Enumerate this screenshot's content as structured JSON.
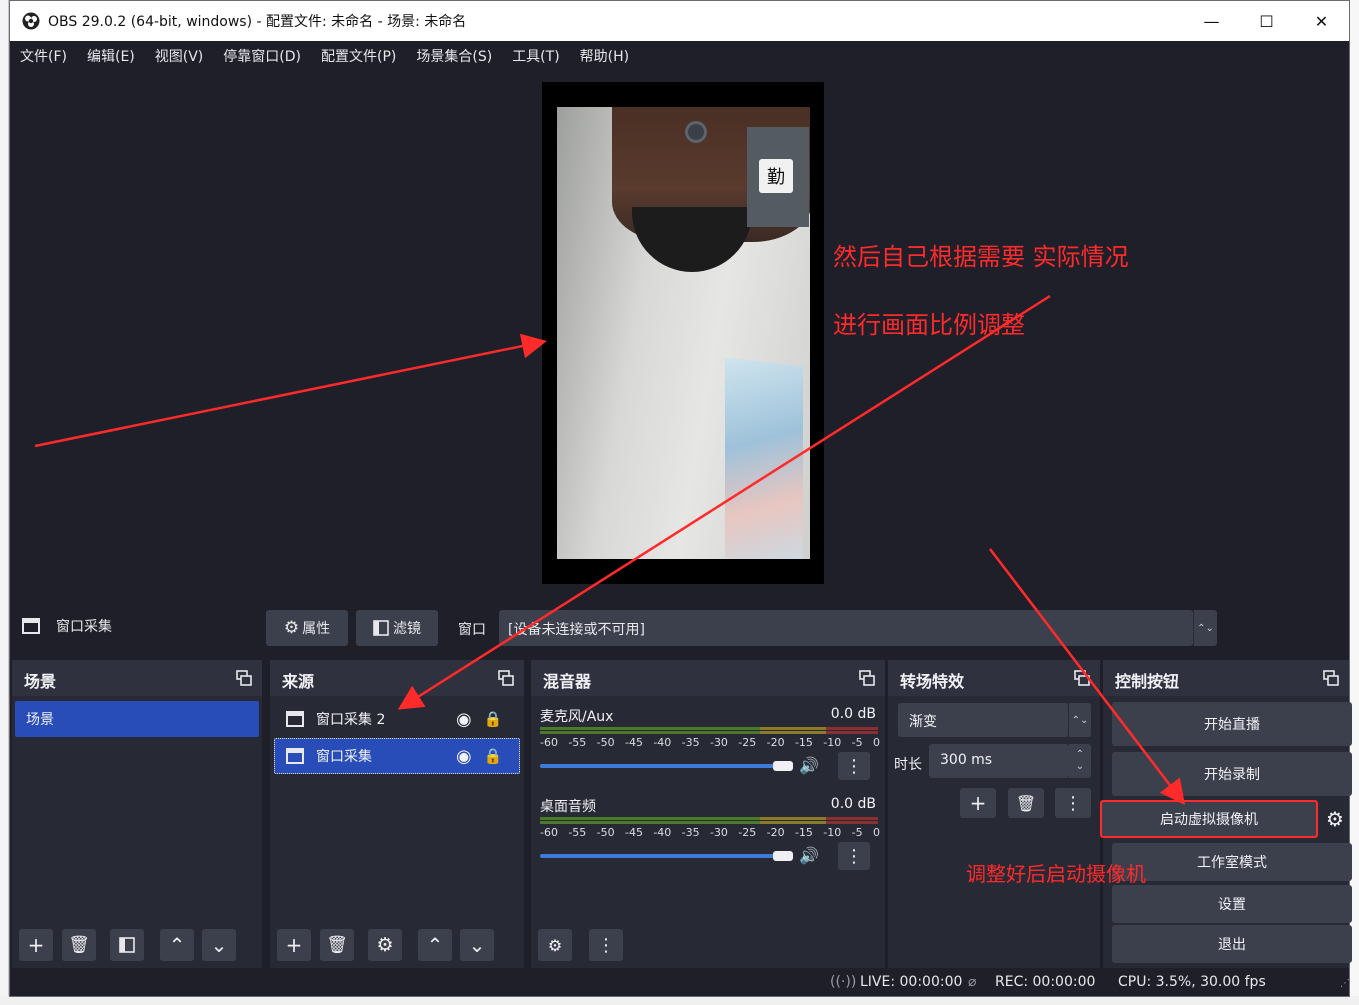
{
  "window": {
    "title": "OBS 29.0.2 (64-bit, windows) - 配置文件: 未命名 - 场景: 未命名",
    "minimize": "—",
    "maximize": "☐",
    "close": "✕"
  },
  "menu": [
    "文件(F)",
    "编辑(E)",
    "视图(V)",
    "停靠窗口(D)",
    "配置文件(P)",
    "场景集合(S)",
    "工具(T)",
    "帮助(H)"
  ],
  "preview": {
    "tag_char": "勤",
    "annotation_1": "然后自己根据需要 实际情况",
    "annotation_2": "进行画面比例调整"
  },
  "source_toolbar": {
    "source_name": "窗口采集",
    "properties_label": "属性",
    "filters_label": "滤镜",
    "window_label": "窗口",
    "window_value": "[设备未连接或不可用]"
  },
  "scenes": {
    "title": "场景",
    "items": [
      "场景"
    ]
  },
  "sources": {
    "title": "来源",
    "items": [
      "窗口采集 2",
      "窗口采集"
    ]
  },
  "mixer": {
    "title": "混音器",
    "channels": [
      {
        "name": "麦克风/Aux",
        "db": "0.0 dB"
      },
      {
        "name": "桌面音频",
        "db": "0.0 dB"
      }
    ],
    "ticks": [
      "-60",
      "-55",
      "-50",
      "-45",
      "-40",
      "-35",
      "-30",
      "-25",
      "-20",
      "-15",
      "-10",
      "-5",
      "0"
    ]
  },
  "transitions": {
    "title": "转场特效",
    "type": "渐变",
    "duration_label": "时长",
    "duration_value": "300 ms"
  },
  "controls": {
    "title": "控制按钮",
    "start_streaming": "开始直播",
    "start_recording": "开始录制",
    "start_virtual_camera": "启动虚拟摄像机",
    "studio_mode": "工作室模式",
    "settings": "设置",
    "exit": "退出",
    "annotation": "调整好后启动摄像机"
  },
  "status": {
    "live": "LIVE: 00:00:00",
    "rec": "REC: 00:00:00",
    "cpu": "CPU: 3.5%, 30.00 fps"
  },
  "colors": {
    "panel": "#272935",
    "header": "#2f313e",
    "button": "#3c404d",
    "selected": "#284cb8",
    "annotation": "#ff2a2a"
  }
}
